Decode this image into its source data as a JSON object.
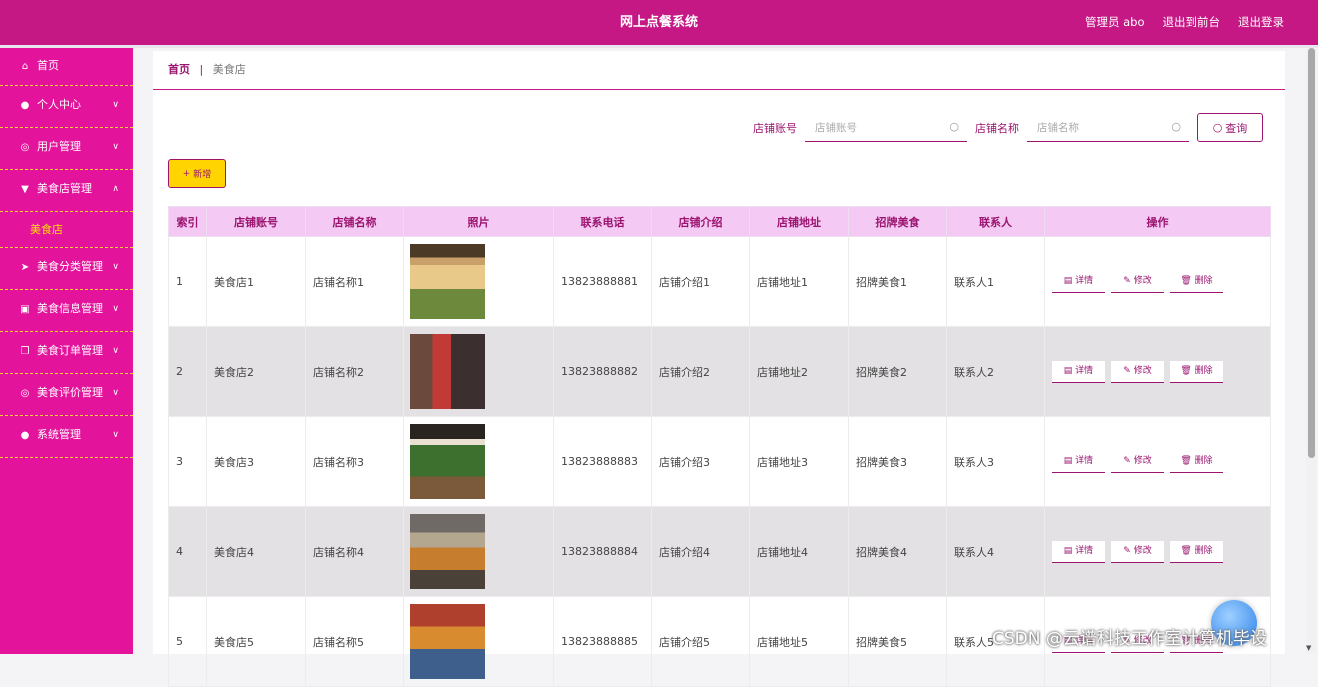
{
  "header": {
    "title": "网上点餐系统",
    "admin": "管理员 abo",
    "to_front": "退出到前台",
    "logout": "退出登录"
  },
  "sidebar": {
    "items": [
      {
        "label": "首页",
        "icon": "home-icon"
      },
      {
        "label": "个人中心",
        "icon": "user-icon"
      },
      {
        "label": "用户管理",
        "icon": "compass-icon"
      },
      {
        "label": "美食店管理",
        "icon": "shop-icon"
      },
      {
        "label": "美食分类管理",
        "icon": "send-icon"
      },
      {
        "label": "美食信息管理",
        "icon": "clipboard-icon"
      },
      {
        "label": "美食订单管理",
        "icon": "copy-icon"
      },
      {
        "label": "美食评价管理",
        "icon": "compass-icon"
      },
      {
        "label": "系统管理",
        "icon": "user-icon"
      }
    ],
    "submenu": {
      "label": "美食店"
    }
  },
  "breadcrumb": {
    "home": "首页",
    "sep": "|",
    "current": "美食店"
  },
  "search": {
    "account_label": "店铺账号",
    "account_placeholder": "店铺账号",
    "name_label": "店铺名称",
    "name_placeholder": "店铺名称",
    "query_label": "查询"
  },
  "toolbar": {
    "add_label": "新增"
  },
  "table": {
    "headers": [
      "索引",
      "店铺账号",
      "店铺名称",
      "照片",
      "联系电话",
      "店铺介绍",
      "店铺地址",
      "招牌美食",
      "联系人",
      "操作"
    ],
    "rows": [
      {
        "index": "1",
        "account": "美食店1",
        "name": "店铺名称1",
        "phone": "13823888881",
        "intro": "店铺介绍1",
        "address": "店铺地址1",
        "signature": "招牌美食1",
        "contact": "联系人1"
      },
      {
        "index": "2",
        "account": "美食店2",
        "name": "店铺名称2",
        "phone": "13823888882",
        "intro": "店铺介绍2",
        "address": "店铺地址2",
        "signature": "招牌美食2",
        "contact": "联系人2"
      },
      {
        "index": "3",
        "account": "美食店3",
        "name": "店铺名称3",
        "phone": "13823888883",
        "intro": "店铺介绍3",
        "address": "店铺地址3",
        "signature": "招牌美食3",
        "contact": "联系人3"
      },
      {
        "index": "4",
        "account": "美食店4",
        "name": "店铺名称4",
        "phone": "13823888884",
        "intro": "店铺介绍4",
        "address": "店铺地址4",
        "signature": "招牌美食4",
        "contact": "联系人4"
      },
      {
        "index": "5",
        "account": "美食店5",
        "name": "店铺名称5",
        "phone": "13823888885",
        "intro": "店铺介绍5",
        "address": "店铺地址5",
        "signature": "招牌美食5",
        "contact": "联系人5"
      }
    ],
    "actions": {
      "detail": "详情",
      "edit": "修改",
      "delete": "删除"
    }
  },
  "watermark": "CSDN @云谱科技工作室计算机毕设",
  "colors": {
    "header": "#c51884",
    "sidebar": "#e3139b",
    "accent": "#9b1570",
    "table_header": "#f4c9f3",
    "add_button": "#ffd400"
  }
}
